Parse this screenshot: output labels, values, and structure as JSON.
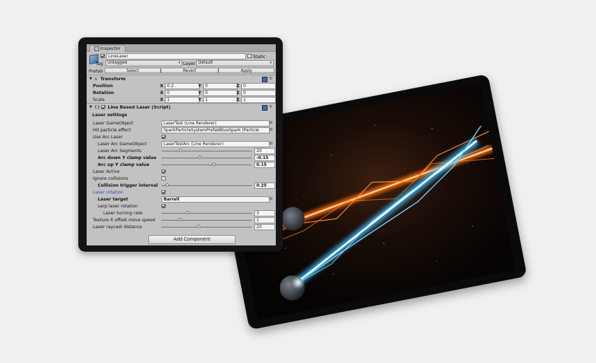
{
  "inspector": {
    "tab_label": "Inspector",
    "object": {
      "name": "LineLaser",
      "static_label": "Static",
      "static_checked": false,
      "active_checked": true,
      "tag_label": "Tag",
      "tag_value": "Untagged",
      "layer_label": "Layer",
      "layer_value": "Default",
      "prefab_label": "Prefab",
      "prefab_select": "Select",
      "prefab_revert": "Revert",
      "prefab_apply": "Apply"
    },
    "transform": {
      "title": "Transform",
      "position_label": "Position",
      "rotation_label": "Rotation",
      "scale_label": "Scale",
      "axis_x": "X",
      "axis_y": "Y",
      "axis_z": "Z",
      "position": {
        "x": "0.2",
        "y": "0",
        "z": "0"
      },
      "rotation": {
        "x": "0",
        "y": "0",
        "z": "0"
      },
      "scale": {
        "x": "1",
        "y": "1",
        "z": "1"
      }
    },
    "script": {
      "title": "Line Based Laser (Script)",
      "enabled": true,
      "settings_header": "Laser settings",
      "laser_gameobject_label": "Laser GameObject",
      "laser_gameobject_value": "LaserTest (Line Renderer)",
      "hit_particle_label": "Hit particle effect",
      "hit_particle_value": "SparkParticleSystemPrefabBlueSpark (Particle",
      "use_arc_label": "Use Arc Laser",
      "use_arc_checked": true,
      "arc_gameobject_label": "Laser Arc GameObject",
      "arc_gameobject_value": "LaserTestArc (Line Renderer)",
      "arc_segments_label": "Laser Arc Segments",
      "arc_segments_value": "20",
      "arc_segments_level": 0.2,
      "arc_down_label": "Arc down Y clamp value",
      "arc_down_value": "-0.15",
      "arc_down_level": 0.42,
      "arc_up_label": "Arc up Y clamp value",
      "arc_up_value": "0.15",
      "arc_up_level": 0.58,
      "laser_active_label": "Laser Active",
      "laser_active_checked": true,
      "ignore_collisions_label": "Ignore collisions",
      "ignore_collisions_checked": false,
      "collision_interval_label": "Collision trigger interval",
      "collision_interval_value": "0.25",
      "collision_interval_level": 0.05,
      "laser_rotation_label": "Laser rotation",
      "laser_rotation_checked": true,
      "laser_target_label": "Laser target",
      "laser_target_value": "Barrell",
      "lerp_rotation_label": "Lerp laser rotation",
      "lerp_rotation_checked": true,
      "turning_rate_label": "Laser turning rate",
      "turning_rate_value": "3",
      "turning_rate_level": 0.28,
      "texture_offset_label": "Texture X offset move speed",
      "texture_offset_value": "1",
      "texture_offset_level": 0.2,
      "raycast_distance_label": "Laser raycast distance",
      "raycast_distance_value": "20",
      "raycast_distance_level": 0.41
    },
    "add_component_label": "Add Component"
  },
  "colors": {
    "inspector_bg": "#c2c2c2",
    "laser_blue": "#8fe8ff",
    "laser_orange": "#ff7a1a",
    "highlight_blue": "#2a47c8"
  }
}
